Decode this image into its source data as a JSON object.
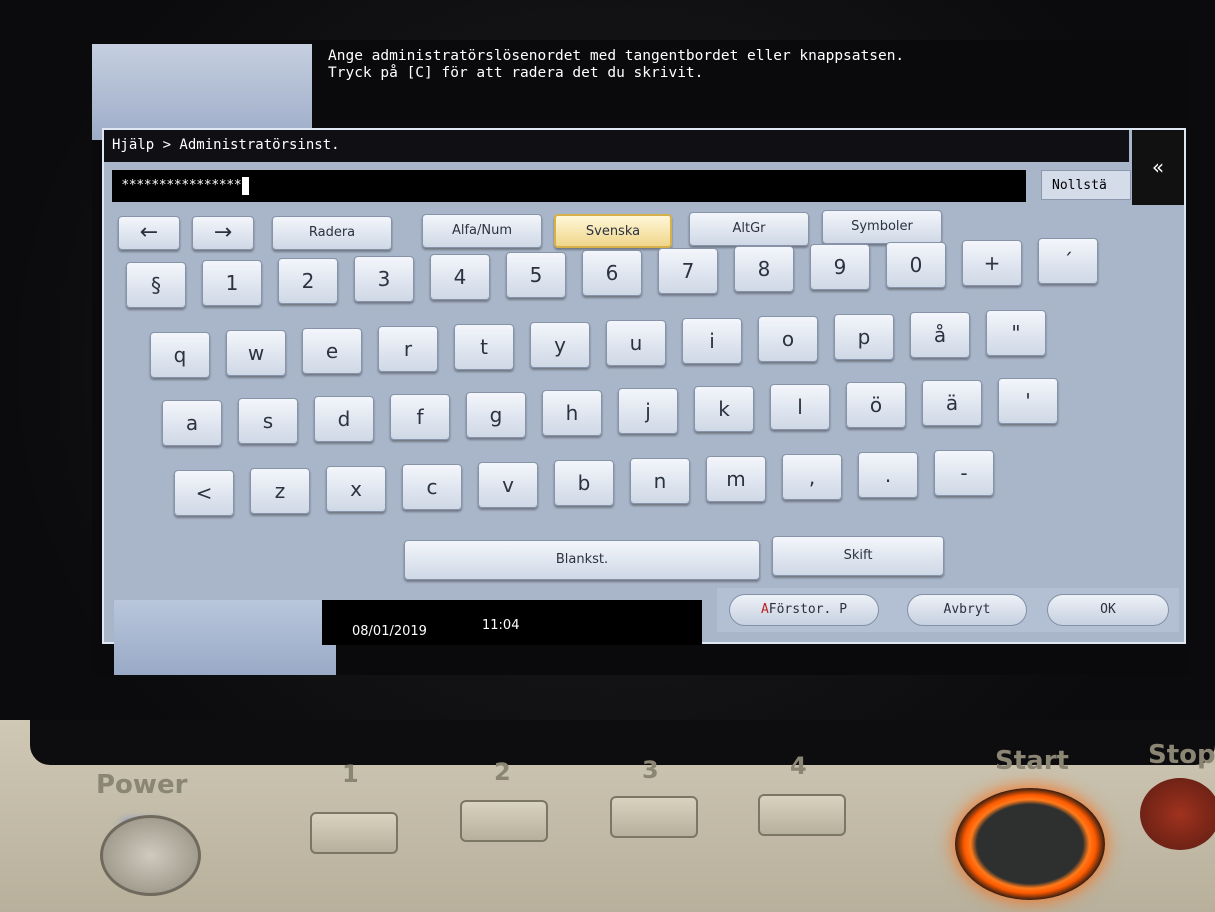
{
  "screen": {
    "message_line1": "Ange administratörslösenordet med tangentbordet eller knappsatsen.",
    "message_line2": "Tryck på [C] för att radera det du skrivit."
  },
  "panel": {
    "breadcrumb": "Hjälp > Administratörsinst.",
    "password_mask": "****************",
    "reset_label": "Nollstä",
    "collapse_icon": "«"
  },
  "toolbar": {
    "left_arrow": "←",
    "right_arrow": "→",
    "delete": "Radera",
    "alphanum": "Alfa/Num",
    "swedish": "Svenska",
    "altgr": "AltGr",
    "symbols": "Symboler"
  },
  "keys": {
    "row1": [
      "§",
      "1",
      "2",
      "3",
      "4",
      "5",
      "6",
      "7",
      "8",
      "9",
      "0",
      "+",
      "´"
    ],
    "row2": [
      "q",
      "w",
      "e",
      "r",
      "t",
      "y",
      "u",
      "i",
      "o",
      "p",
      "å",
      "\""
    ],
    "row3": [
      "a",
      "s",
      "d",
      "f",
      "g",
      "h",
      "j",
      "k",
      "l",
      "ö",
      "ä",
      "'"
    ],
    "row4": [
      "<",
      "z",
      "x",
      "c",
      "v",
      "b",
      "n",
      "m",
      ",",
      ".",
      "-"
    ],
    "space": "Blankst.",
    "shift": "Skift"
  },
  "status": {
    "date": "08/01/2019",
    "time": "11:04"
  },
  "buttons": {
    "enlarge": "Förstor. P",
    "cancel": "Avbryt",
    "ok": "OK"
  },
  "hardware": {
    "power": "Power",
    "start": "Start",
    "stop": "Stop",
    "keys": [
      "1",
      "2",
      "3",
      "4"
    ]
  }
}
